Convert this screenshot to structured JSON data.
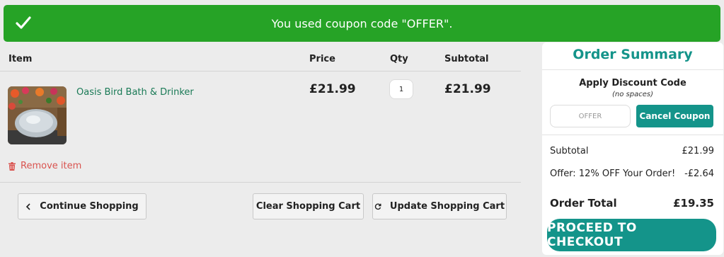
{
  "banner": {
    "message": "You used coupon code \"OFFER\"."
  },
  "cart": {
    "headers": {
      "item": "Item",
      "price": "Price",
      "qty": "Qty",
      "subtotal": "Subtotal"
    },
    "items": [
      {
        "name": "Oasis Bird Bath & Drinker",
        "price": "£21.99",
        "qty": "1",
        "subtotal": "£21.99"
      }
    ],
    "remove_label": "Remove item"
  },
  "buttons": {
    "continue": "Continue Shopping",
    "clear": "Clear Shopping Cart",
    "update": "Update Shopping Cart"
  },
  "summary": {
    "title": "Order Summary",
    "discount_title": "Apply Discount Code",
    "discount_sub": "(no spaces)",
    "coupon_value": "OFFER",
    "cancel_label": "Cancel Coupon",
    "subtotal_label": "Subtotal",
    "subtotal_value": "£21.99",
    "offer_label": "Offer: 12% OFF Your Order!",
    "offer_value": "-£2.64",
    "total_label": "Order Total",
    "total_value": "£19.35",
    "checkout_label": "PROCEED TO CHECKOUT"
  },
  "colors": {
    "banner": "#26a326",
    "accent": "#14948a",
    "remove": "#d9534f",
    "link": "#1a7a56"
  },
  "icons": [
    "check-icon",
    "trash-icon",
    "chevron-left-icon",
    "refresh-icon"
  ]
}
